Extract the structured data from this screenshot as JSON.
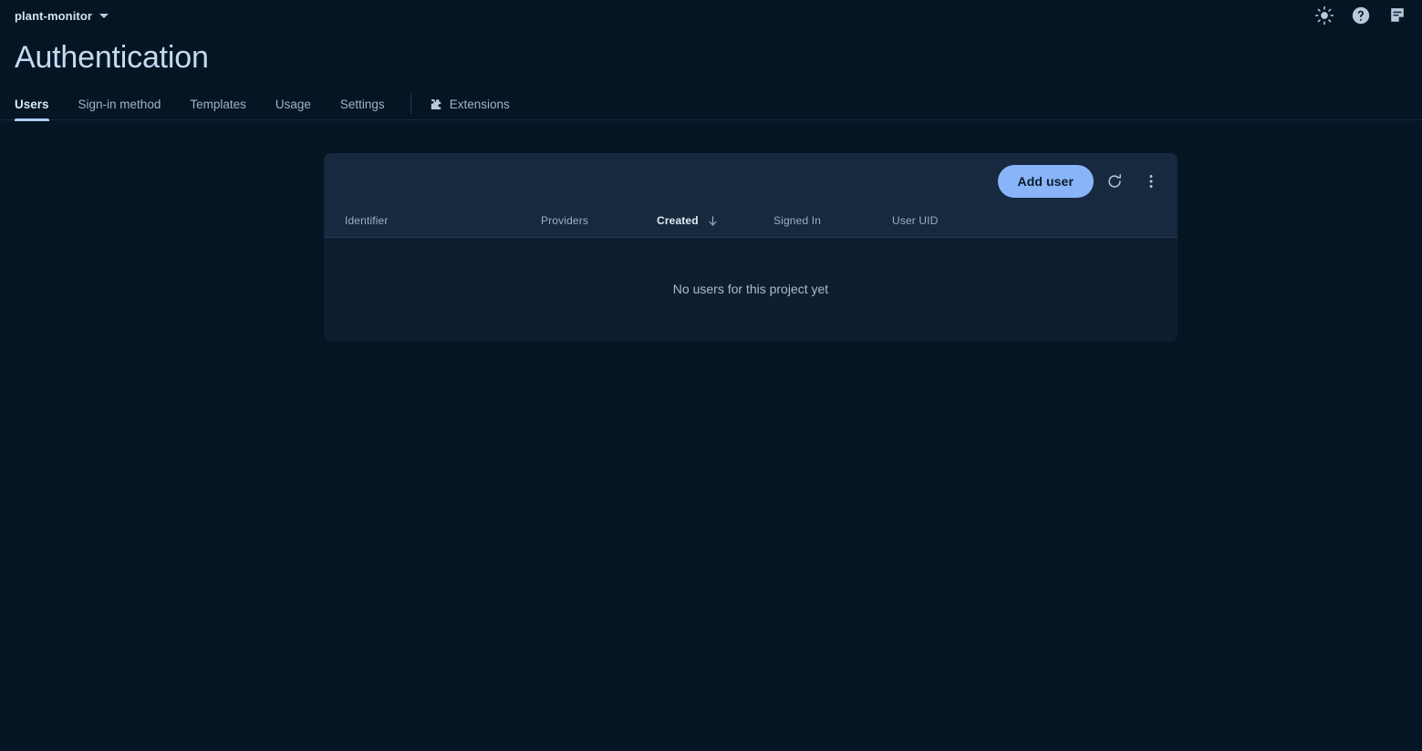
{
  "topbar": {
    "project_name": "plant-monitor",
    "caret_icon": "chevron-down-icon",
    "actions": [
      {
        "name": "brightness-icon",
        "label": "Toggle dark mode"
      },
      {
        "name": "help-icon",
        "label": "Help"
      },
      {
        "name": "feedback-icon",
        "label": "Send feedback"
      }
    ]
  },
  "page": {
    "title": "Authentication"
  },
  "tabs": [
    {
      "label": "Users",
      "active": true
    },
    {
      "label": "Sign-in method",
      "active": false
    },
    {
      "label": "Templates",
      "active": false
    },
    {
      "label": "Usage",
      "active": false
    },
    {
      "label": "Settings",
      "active": false
    },
    {
      "label": "Extensions",
      "active": false,
      "icon": "extensions-icon"
    }
  ],
  "users_card": {
    "toolbar": {
      "add_user_label": "Add user",
      "refresh_icon": "refresh-icon",
      "more_options_icon": "more-vert-icon"
    },
    "columns": [
      {
        "label": "Identifier",
        "sorted": false
      },
      {
        "label": "Providers",
        "sorted": false
      },
      {
        "label": "Created",
        "sorted": true,
        "sort_icon": "arrow-down-icon"
      },
      {
        "label": "Signed In",
        "sorted": false
      },
      {
        "label": "User UID",
        "sorted": false
      }
    ],
    "empty_state_message": "No users for this project yet"
  },
  "colors": {
    "page_background": "#061523",
    "card_background": "#0e1e30",
    "card_header_background": "#17293f",
    "accent": "#8ab4f8",
    "tab_indicator": "#aecbfa",
    "title_text": "#c4daf2"
  }
}
